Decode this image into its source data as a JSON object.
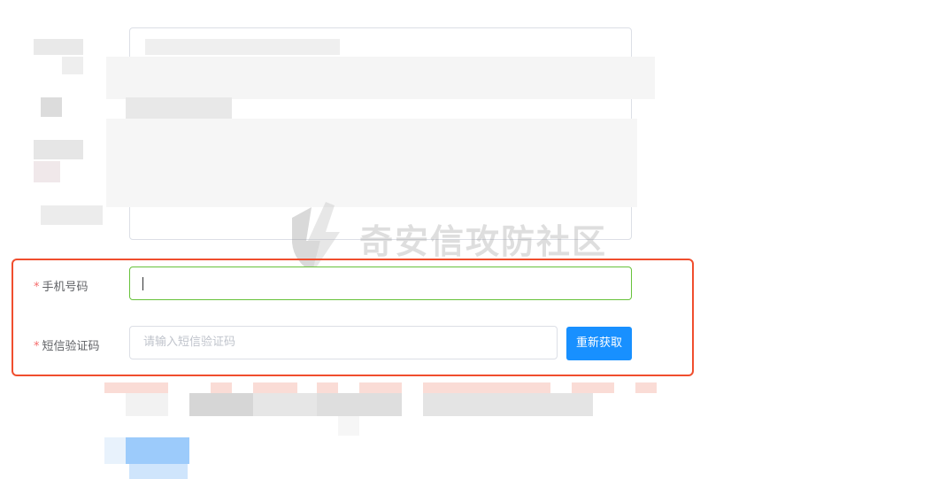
{
  "watermark": {
    "text": "奇安信攻防社区"
  },
  "form": {
    "phone": {
      "label": "手机号码",
      "required_mark": "*",
      "value": ""
    },
    "sms_code": {
      "label": "短信验证码",
      "required_mark": "*",
      "placeholder": "请输入短信验证码"
    },
    "resend_button_label": "重新获取"
  },
  "colors": {
    "accent": "#1890ff",
    "active_border": "#67c23a",
    "highlight": "#f04e2e",
    "required": "#f56c6c"
  }
}
